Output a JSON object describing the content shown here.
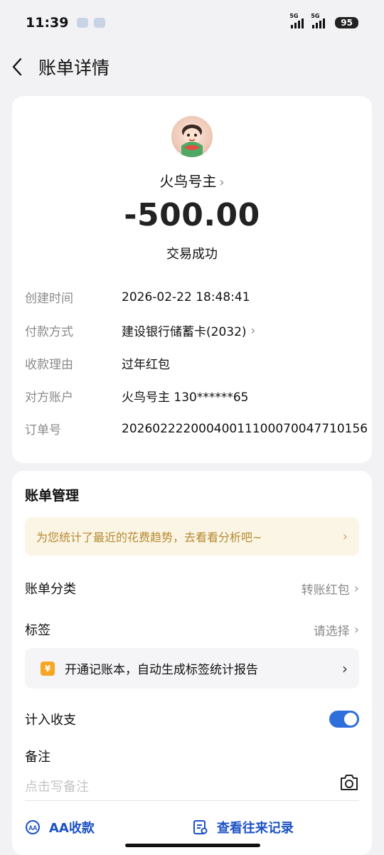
{
  "status_bar": {
    "time": "11:39",
    "network1": "5G",
    "network2": "5G",
    "battery": "95"
  },
  "header": {
    "title": "账单详情"
  },
  "transaction": {
    "payee": "火鸟号主",
    "amount": "-500.00",
    "status": "交易成功",
    "details": [
      {
        "key": "创建时间",
        "value": "2026-02-22 18:48:41",
        "has_chevron": false
      },
      {
        "key": "付款方式",
        "value": "建设银行储蓄卡(2032)",
        "has_chevron": true
      },
      {
        "key": "收款理由",
        "value": "过年红包",
        "has_chevron": false
      },
      {
        "key": "对方账户",
        "value": "火鸟号主 130******65",
        "has_chevron": false
      },
      {
        "key": "订单号",
        "value": "20260222200040011100070047710156",
        "has_chevron": false
      }
    ]
  },
  "management": {
    "title": "账单管理",
    "tip": "为您统计了最近的花费趋势，去看看分析吧~",
    "category_label": "账单分类",
    "category_value": "转账红包",
    "tag_label": "标签",
    "tag_value": "请选择",
    "promo_text": "开通记账本，自动生成标签统计报告",
    "include_label": "计入收支",
    "include_enabled": true,
    "note_label": "备注",
    "note_placeholder": "点击写备注"
  },
  "actions": {
    "aa": "AA收款",
    "history": "查看往来记录"
  },
  "colors": {
    "accent": "#2f6fdb",
    "link": "#1d52c4",
    "tip_text": "#b58a2f"
  }
}
